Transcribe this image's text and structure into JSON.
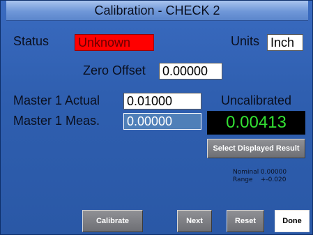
{
  "window": {
    "title": "Calibration - CHECK 2"
  },
  "status": {
    "label": "Status",
    "value": "Unknown"
  },
  "units": {
    "label": "Units",
    "value": "Inch"
  },
  "zero_offset": {
    "label": "Zero Offset",
    "value": "0.00000"
  },
  "master_actual": {
    "label": "Master 1 Actual",
    "value": "0.01000"
  },
  "master_meas": {
    "label": "Master 1 Meas.",
    "value": "0.00000"
  },
  "calibration_state": "Uncalibrated",
  "result_value": "0.00413",
  "select_result_label": "Select Displayed Result",
  "nominal": {
    "label": "Nominal",
    "value": "0.00000"
  },
  "range": {
    "label": "Range",
    "value": "+-0.020"
  },
  "buttons": {
    "calibrate": "Calibrate",
    "next": "Next",
    "reset": "Reset",
    "done": "Done"
  },
  "colors": {
    "status_bad": "#ff0000",
    "result_text": "#33e033",
    "background": "#2f5fb0"
  }
}
